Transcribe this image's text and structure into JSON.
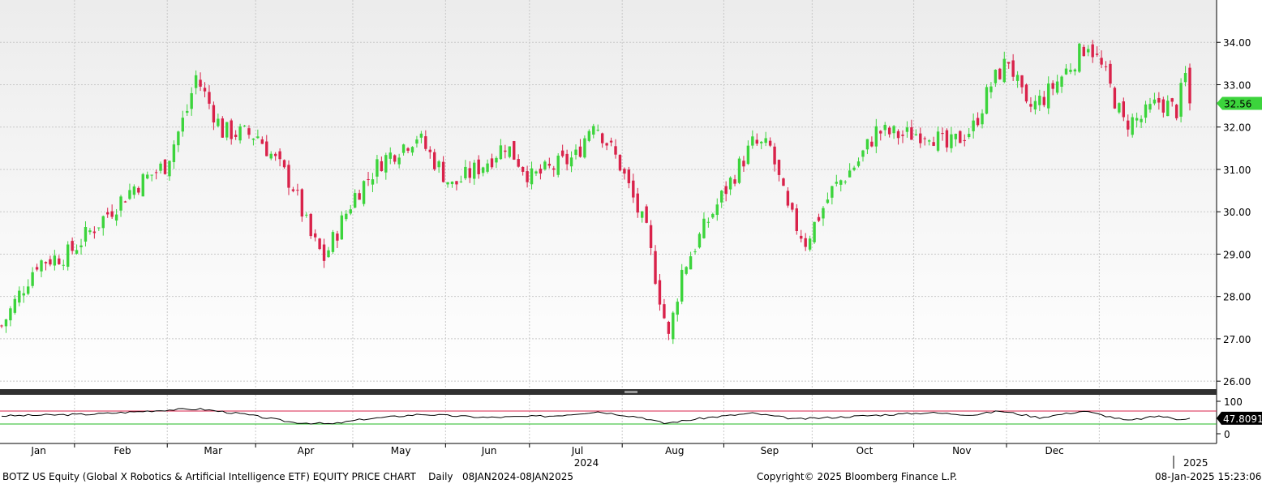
{
  "chart_data": {
    "type": "candlestick",
    "ticker_line": "BOTZ US Equity (Global X Robotics & Artificial Intelligence ETF) EQUITY PRICE CHART",
    "period": "Daily",
    "date_range": "08JAN2024-08JAN2025",
    "copyright": "Copyright© 2025 Bloomberg Finance L.P.",
    "timestamp": "08-Jan-2025 15:23:06",
    "price_axis": {
      "ylim": [
        25.85,
        35.0
      ],
      "ticks": [
        "26.00",
        "27.00",
        "28.00",
        "29.00",
        "30.00",
        "31.00",
        "32.00",
        "33.00",
        "34.00"
      ]
    },
    "last_price": "32.56",
    "rsi": {
      "last": "47.8091",
      "ticks": [
        "100",
        "0"
      ],
      "upper_line": 70,
      "lower_line": 30
    },
    "months": [
      "Jan",
      "Feb",
      "Mar",
      "Apr",
      "May",
      "Jun",
      "Jul",
      "Aug",
      "Sep",
      "Oct",
      "Nov",
      "Dec"
    ],
    "year_labels": [
      "2024",
      "2025"
    ],
    "anchors": [
      [
        0,
        27.3
      ],
      [
        8,
        28.8
      ],
      [
        15,
        29.0
      ],
      [
        30,
        30.6
      ],
      [
        37,
        31.1
      ],
      [
        42,
        32.4
      ],
      [
        44,
        33.2
      ],
      [
        50,
        31.9
      ],
      [
        58,
        31.8
      ],
      [
        66,
        30.6
      ],
      [
        70,
        29.4
      ],
      [
        73,
        28.9
      ],
      [
        80,
        30.4
      ],
      [
        86,
        31.2
      ],
      [
        94,
        31.8
      ],
      [
        102,
        30.6
      ],
      [
        110,
        31.2
      ],
      [
        114,
        31.6
      ],
      [
        120,
        30.8
      ],
      [
        130,
        31.3
      ],
      [
        134,
        32.2
      ],
      [
        140,
        31.1
      ],
      [
        146,
        29.5
      ],
      [
        149,
        28.0
      ],
      [
        151,
        27.0
      ],
      [
        154,
        28.6
      ],
      [
        160,
        29.8
      ],
      [
        166,
        30.9
      ],
      [
        170,
        31.6
      ],
      [
        174,
        31.5
      ],
      [
        178,
        30.0
      ],
      [
        182,
        29.3
      ],
      [
        188,
        30.5
      ],
      [
        194,
        31.2
      ],
      [
        198,
        31.9
      ],
      [
        204,
        31.8
      ],
      [
        210,
        31.9
      ],
      [
        214,
        31.5
      ],
      [
        220,
        32.0
      ],
      [
        224,
        33.0
      ],
      [
        228,
        33.6
      ],
      [
        232,
        32.4
      ],
      [
        236,
        32.7
      ],
      [
        240,
        33.2
      ],
      [
        246,
        34.0
      ],
      [
        250,
        33.2
      ],
      [
        254,
        32.1
      ],
      [
        258,
        32.2
      ],
      [
        262,
        32.6
      ],
      [
        266,
        32.4
      ],
      [
        268,
        33.2
      ],
      [
        269,
        32.56
      ]
    ],
    "rsi_anchors": [
      [
        0,
        55
      ],
      [
        20,
        60
      ],
      [
        40,
        75
      ],
      [
        45,
        76
      ],
      [
        55,
        60
      ],
      [
        66,
        35
      ],
      [
        75,
        30
      ],
      [
        82,
        45
      ],
      [
        95,
        60
      ],
      [
        110,
        50
      ],
      [
        125,
        55
      ],
      [
        135,
        68
      ],
      [
        145,
        50
      ],
      [
        150,
        32
      ],
      [
        160,
        50
      ],
      [
        170,
        63
      ],
      [
        180,
        45
      ],
      [
        195,
        55
      ],
      [
        210,
        65
      ],
      [
        220,
        58
      ],
      [
        226,
        70
      ],
      [
        235,
        50
      ],
      [
        245,
        70
      ],
      [
        255,
        40
      ],
      [
        262,
        55
      ],
      [
        266,
        45
      ],
      [
        269,
        47.8
      ]
    ]
  },
  "icons": {
    "divider": "divider-handle-icon"
  }
}
